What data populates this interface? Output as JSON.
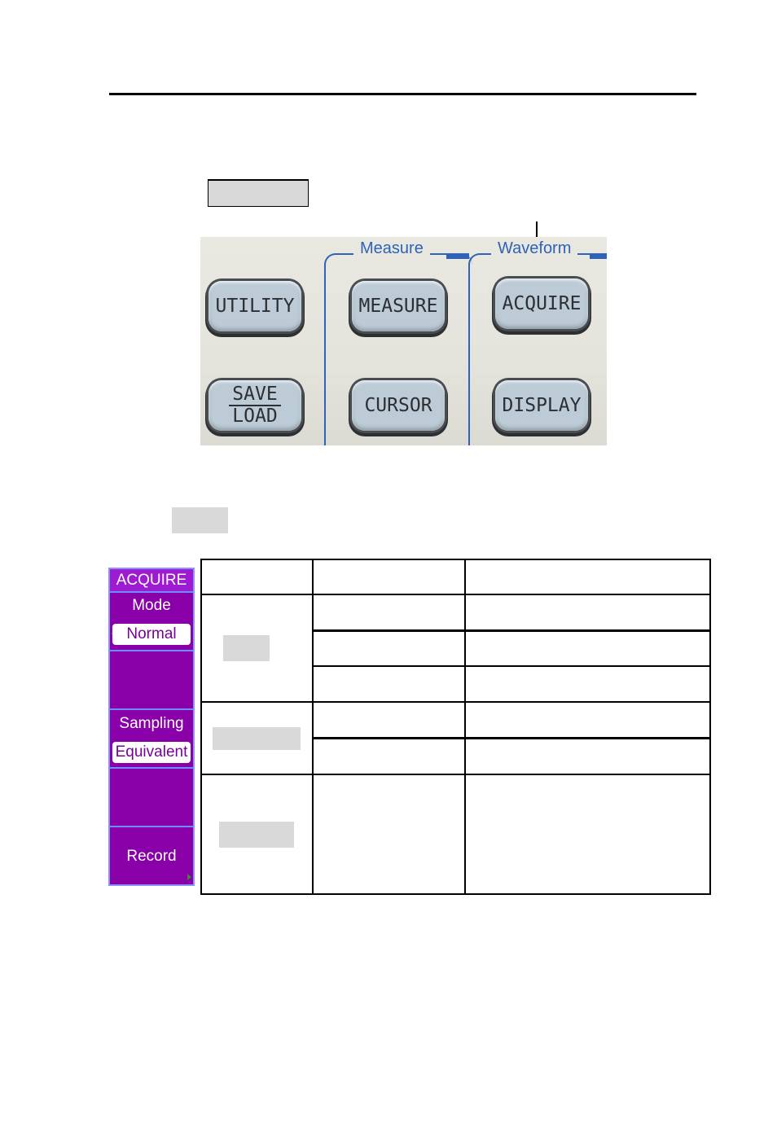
{
  "page": {
    "section_label_placeholder": "",
    "sub_label_placeholder": ""
  },
  "front_panel": {
    "groups": {
      "measure": "Measure",
      "waveform": "Waveform"
    },
    "keys": {
      "utility": "UTILITY",
      "measure": "MEASURE",
      "acquire": "ACQUIRE",
      "save": "SAVE",
      "load": "LOAD",
      "cursor": "CURSOR",
      "display": "DISPLAY"
    },
    "highlighted_key": "ACQUIRE"
  },
  "acquire_menu": {
    "title": "ACQUIRE",
    "items": [
      {
        "label": "Mode",
        "value": "Normal"
      },
      {
        "label": "",
        "value": ""
      },
      {
        "label": "Sampling",
        "value": "Equivalent"
      },
      {
        "label": "",
        "value": ""
      },
      {
        "label": "Record",
        "value": ""
      }
    ],
    "colors": {
      "background": "#8a00a8",
      "title_background": "#9d1bd0",
      "separator": "#6f8cff",
      "value_text": "#7a009a"
    }
  },
  "function_table": {
    "columns": [
      "",
      "",
      ""
    ],
    "rows": [
      {
        "group": "",
        "options": [
          "",
          "",
          ""
        ],
        "descriptions": [
          "",
          "",
          ""
        ]
      },
      {
        "group": "",
        "options": [
          "",
          ""
        ],
        "descriptions": [
          "",
          ""
        ]
      },
      {
        "group": "",
        "options": [
          ""
        ],
        "descriptions": [
          ""
        ]
      }
    ]
  }
}
